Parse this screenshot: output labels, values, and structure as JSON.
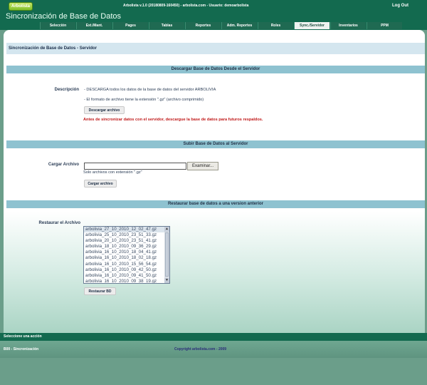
{
  "header": {
    "logo_text": "Arbolista",
    "version_text": "Arbolista v.1.0 (20180809-160450) - arbolista.com - Usuario: demoarbolista",
    "logout_label": "Log Out",
    "app_title": "Sincronización de Base de Datos"
  },
  "nav": {
    "tabs": [
      {
        "label": "Selección",
        "active": false
      },
      {
        "label": "Ext./Mant.",
        "active": false
      },
      {
        "label": "Pages",
        "active": false
      },
      {
        "label": "Tablas",
        "active": false
      },
      {
        "label": "Reportes",
        "active": false
      },
      {
        "label": "Adm. Reportes",
        "active": false
      },
      {
        "label": "Roles",
        "active": false
      },
      {
        "label": "Sync./Servidor",
        "active": true
      },
      {
        "label": "Inventarios",
        "active": false
      },
      {
        "label": "PPM",
        "active": false
      }
    ]
  },
  "main": {
    "page_heading": "Sincronización de Base de Datos - Servidor",
    "download": {
      "section_title": "Descargar Base de Datos Desde el Servidor",
      "description_label": "Descripción",
      "line1": "- DESCARGA todos los datos de la base de datos del servidor ARBOLIVIA",
      "line2": "- El formato de archivo tiene la extensión \".gz\" (archivo comprimido)",
      "button_label": "Descargar archivo",
      "warning": "Antes de sincronizar datos con el servidor, descargue la base de datos para futuros respaldos."
    },
    "upload": {
      "section_title": "Subir Base de Datos al Servidor",
      "field_label": "Cargar Archivo",
      "file_value": "",
      "browse_label": "Examinar...",
      "hint": "Solo archivos con extensión \".gz\"",
      "button_label": "Cargar archivo"
    },
    "restore": {
      "section_title": "Restaurar base de datos a una version anterior",
      "field_label": "Restaurar el Archivo",
      "files": [
        "arbolivia_27_10_2010_12_02_47.gz",
        "arbolivia_25_10_2010_23_51_33.gz",
        "arbolivia_20_10_2010_23_51_41.gz",
        "arbolivia_18_10_2010_09_36_29.gz",
        "arbolivia_16_10_2010_18_04_41.gz",
        "arbolivia_16_10_2010_18_02_18.gz",
        "arbolivia_16_10_2010_15_56_54.gz",
        "arbolivia_16_10_2010_09_42_50.gz",
        "arbolivia_16_10_2010_09_41_50.gz",
        "arbolivia_16_10_2010_09_38_19.gz"
      ],
      "button_label": "Restaurar BD"
    }
  },
  "status": {
    "message": "Seleccione una acción"
  },
  "footer": {
    "left": "B00 - Sincronización",
    "center": "Copyright arbolista.com - 2009"
  },
  "colors": {
    "brand_green": "#136a4f",
    "section_bar": "#8ec2d0",
    "heading_bar": "#d4e6ef",
    "warning_red": "#c01818"
  }
}
